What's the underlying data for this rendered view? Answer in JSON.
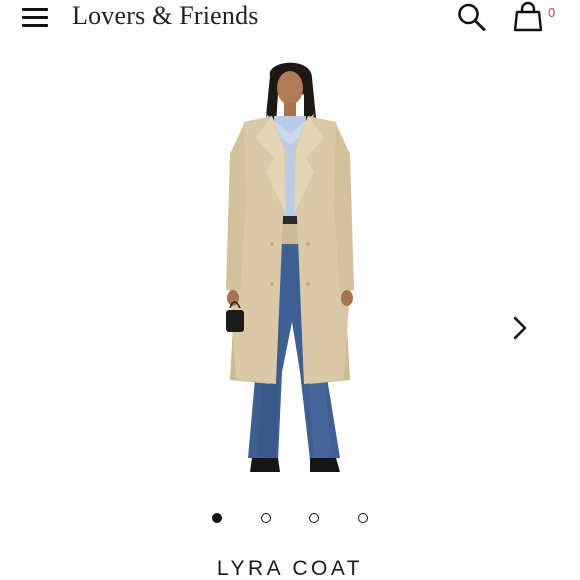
{
  "header": {
    "brand": "Lovers & Friends",
    "menu_icon": "hamburger-menu-icon",
    "search_icon": "search-icon",
    "bag_icon": "shopping-bag-icon",
    "bag_count": "0",
    "bag_count_color": "#c0395b"
  },
  "gallery": {
    "next_icon": "chevron-right-icon",
    "slides_total": 4,
    "active_slide": 1
  },
  "product": {
    "title": "LYRA COAT"
  },
  "colors": {
    "coat": "#d9c9a6",
    "shirt": "#b9cde6",
    "jeans": "#3f5f93"
  }
}
